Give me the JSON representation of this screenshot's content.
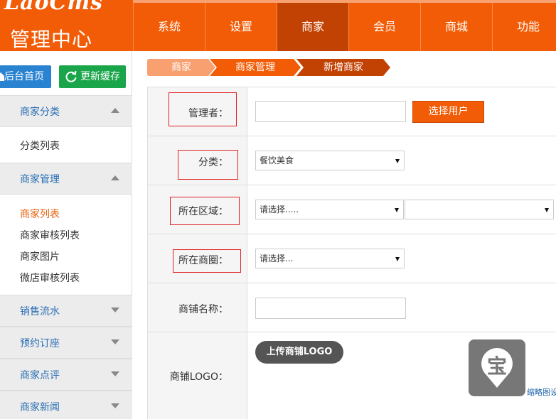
{
  "header": {
    "brand": "LaoCms",
    "title": "管理中心",
    "nav": [
      {
        "label": "系统",
        "active": false
      },
      {
        "label": "设置",
        "active": false
      },
      {
        "label": "商家",
        "active": true
      },
      {
        "label": "会员",
        "active": false
      },
      {
        "label": "商城",
        "active": false
      },
      {
        "label": "功能",
        "active": false
      }
    ]
  },
  "sidebar": {
    "home_label": "后台首页",
    "refresh_label": "更新缓存",
    "sections": [
      {
        "label": "商家分类",
        "expanded": true,
        "items": [
          "分类列表"
        ]
      },
      {
        "label": "商家管理",
        "expanded": true,
        "items": [
          "商家列表",
          "商家审核列表",
          "商家图片",
          "微店审核列表"
        ],
        "active_item": "商家列表"
      },
      {
        "label": "销售流水",
        "expanded": false
      },
      {
        "label": "预约订座",
        "expanded": false
      },
      {
        "label": "商家点评",
        "expanded": false
      },
      {
        "label": "商家新闻",
        "expanded": false
      }
    ]
  },
  "breadcrumb": [
    "商家",
    "商家管理",
    "新增商家"
  ],
  "form": {
    "manager_label": "管理者：",
    "manager_value": "",
    "choose_user_label": "选择用户",
    "category_label": "分类：",
    "category_value": "餐饮美食",
    "region_label": "所在区域：",
    "region_value": "请选择.....",
    "region_sub_value": "",
    "district_label": "所在商圈：",
    "district_value": "请选择...",
    "shop_name_label": "商铺名称：",
    "shop_name_value": "",
    "logo_label": "商铺LOGO：",
    "upload_label": "上传商铺LOGO",
    "thumb_char": "宝",
    "thumb_link": "缩略图设"
  },
  "colors": {
    "accent": "#f25c06",
    "nav_active": "#c24204",
    "link": "#2a6fb4",
    "home_btn": "#2a83d1",
    "refresh_btn": "#1aa54a"
  }
}
